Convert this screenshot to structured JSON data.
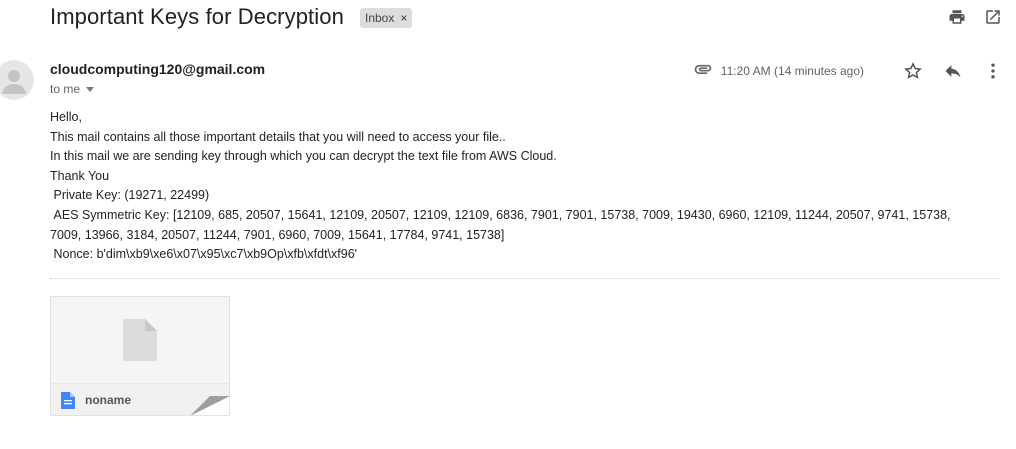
{
  "subject": "Important Keys for Decryption",
  "label": {
    "text": "Inbox",
    "remove_icon": "×"
  },
  "top_actions": {
    "print_icon": "print-icon",
    "open_new_window_icon": "open-in-new-window-icon"
  },
  "sender": {
    "email": "cloudcomputing120@gmail.com",
    "avatar_icon": "person-icon"
  },
  "recipient": {
    "text": "to me"
  },
  "meta": {
    "attachment_icon": "paperclip-icon",
    "time": "11:20 AM (14 minutes ago)",
    "star_icon": "star-icon",
    "reply_icon": "reply-icon",
    "more_icon": "more-vertical-icon"
  },
  "body": {
    "lines": [
      "Hello,",
      "This mail contains all those important details that you will need to access your file..",
      "In this mail we are sending key through which you can decrypt the text file from AWS Cloud.",
      "Thank You",
      " Private Key: (19271, 22499)",
      " AES Symmetric Key: [12109, 685, 20507, 15641, 12109, 20507, 12109, 12109, 6836, 7901, 7901, 15738, 7009, 19430, 6960, 12109, 11244, 20507, 9741, 15738,",
      "7009, 13966, 3184, 20507, 11244, 7901, 6960, 7009, 15641, 17784, 9741, 15738]",
      " Nonce: b'dim\\xb9\\xe6\\x07\\x95\\xc7\\xb9Op\\xfb\\xfdt\\xf96'"
    ]
  },
  "attachment": {
    "name": "noname",
    "file_icon": "document-icon",
    "preview_icon": "file-icon"
  },
  "colors": {
    "attachment_file_icon": "#4285f4",
    "label_chip_bg": "#dddddd"
  }
}
